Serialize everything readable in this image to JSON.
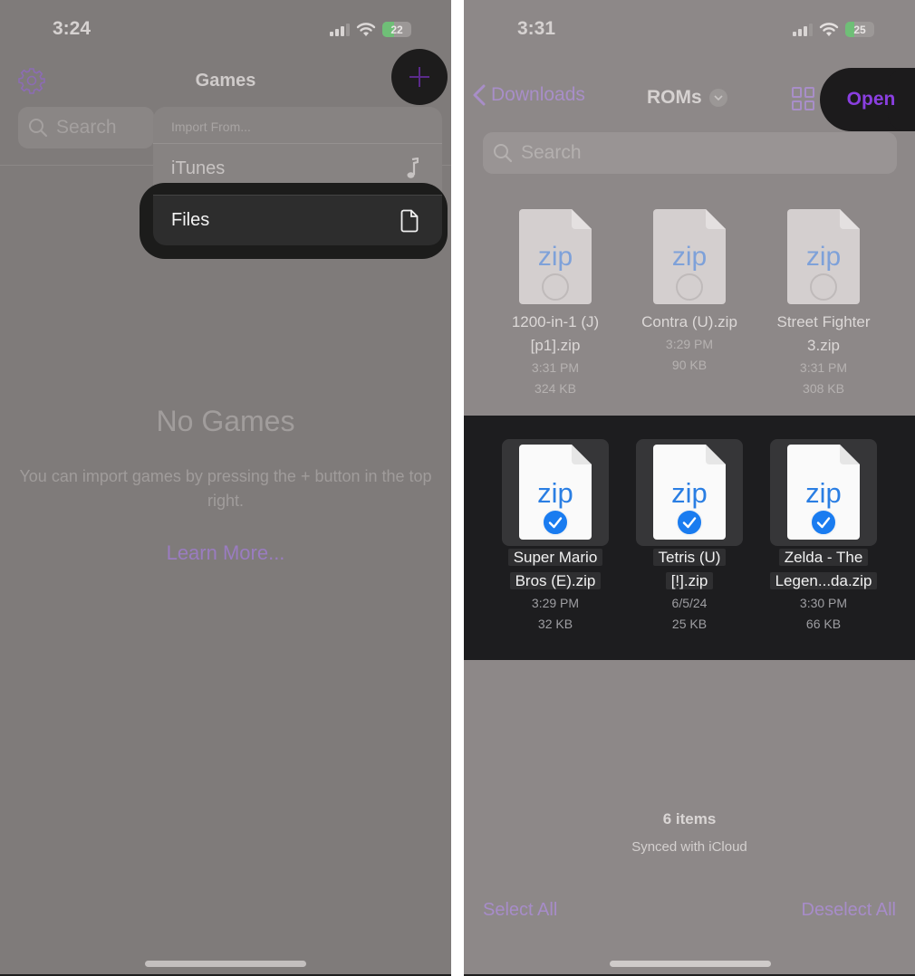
{
  "left_screen": {
    "status_bar": {
      "time": "3:24",
      "battery": "22",
      "battery_level_pct": 22
    },
    "header": {
      "title": "Games",
      "settings_icon": "gear-icon",
      "add_icon": "plus-icon"
    },
    "search": {
      "placeholder": "Search"
    },
    "import_menu": {
      "header": "Import From...",
      "items": [
        {
          "label": "iTunes",
          "icon": "music-note-icon"
        },
        {
          "label": "Files",
          "icon": "document-icon",
          "highlighted": true
        }
      ]
    },
    "empty_state": {
      "title": "No Games",
      "description": "You can import games by pressing the + button in the top right.",
      "link": "Learn More..."
    }
  },
  "right_screen": {
    "status_bar": {
      "time": "3:31",
      "battery": "25",
      "battery_level_pct": 25
    },
    "nav": {
      "back_label": "Downloads",
      "title": "ROMs",
      "open_label": "Open",
      "view_icon": "grid-view-icon"
    },
    "search": {
      "placeholder": "Search"
    },
    "files": [
      {
        "name_line1": "1200-in-1 (J)",
        "name_line2": "[p1].zip",
        "time": "3:31 PM",
        "size": "324 KB",
        "type": "zip",
        "selected": false
      },
      {
        "name_line1": "Contra (U).zip",
        "name_line2": "",
        "time": "3:29 PM",
        "size": "90 KB",
        "type": "zip",
        "selected": false
      },
      {
        "name_line1": "Street Fighter",
        "name_line2": "3.zip",
        "time": "3:31 PM",
        "size": "308 KB",
        "type": "zip",
        "selected": false
      },
      {
        "name_line1": "Super Mario",
        "name_line2": "Bros (E).zip",
        "time": "3:29 PM",
        "size": "32 KB",
        "type": "zip",
        "selected": true
      },
      {
        "name_line1": "Tetris (U)",
        "name_line2": "[!].zip",
        "time": "6/5/24",
        "size": "25 KB",
        "type": "zip",
        "selected": true
      },
      {
        "name_line1": "Zelda - The",
        "name_line2": "Legen...da.zip",
        "time": "3:30 PM",
        "size": "66 KB",
        "type": "zip",
        "selected": true
      }
    ],
    "footer": {
      "count": "6 items",
      "sync_status": "Synced with iCloud",
      "select_all": "Select All",
      "deselect_all": "Deselect All"
    }
  },
  "colors": {
    "accent_purple": "#8a3fe0",
    "dim_purple": "#a88ec8",
    "selection_blue": "#1a7cf0",
    "highlight_dark": "#1c1b1c"
  }
}
